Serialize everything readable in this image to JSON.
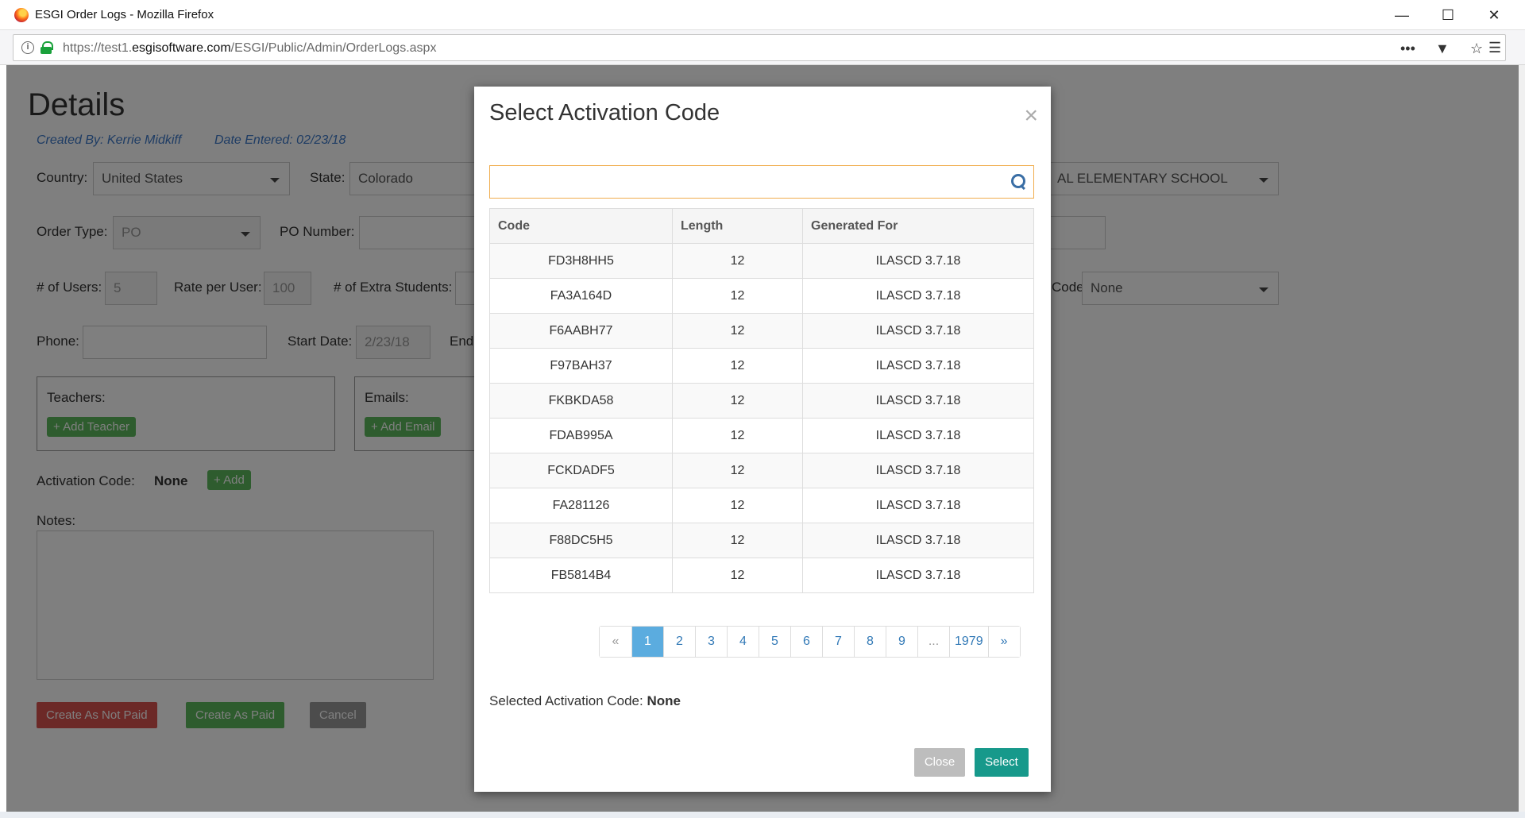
{
  "browser": {
    "window_title": "ESGI Order Logs - Mozilla Firefox",
    "url_prefix": "https://test1.",
    "url_domain": "esgisoftware.com",
    "url_path": "/ESGI/Public/Admin/OrderLogs.aspx"
  },
  "page": {
    "heading": "Details",
    "created_by": "Created By: Kerrie Midkiff",
    "date_entered": "Date Entered: 02/23/18",
    "country_label": "Country:",
    "country_value": "United States",
    "state_label": "State:",
    "state_value": "Colorado",
    "school_value": "AL ELEMENTARY SCHOOL",
    "order_type_label": "Order Type:",
    "order_type_value": "PO",
    "po_number_label": "PO Number:",
    "users_label": "# of Users:",
    "users_value": "5",
    "rate_label": "Rate per User:",
    "rate_value": "100",
    "extra_students_label": "# of Extra Students:",
    "code_label_partial": "Code:",
    "code_value": "None",
    "phone_label": "Phone:",
    "start_date_label": "Start Date:",
    "start_date_value": "2/23/18",
    "end_label_partial": "End",
    "teachers_label": "Teachers:",
    "add_teacher": "+ Add Teacher",
    "emails_label": "Emails:",
    "add_email": "+ Add Email",
    "activation_code_label": "Activation Code:",
    "activation_code_value": "None",
    "add_button": "+ Add",
    "notes_label": "Notes:",
    "create_not_paid": "Create As Not Paid",
    "create_paid": "Create As Paid",
    "cancel": "Cancel"
  },
  "modal": {
    "title": "Select Activation Code",
    "close_glyph": "×",
    "search_placeholder": "",
    "columns": [
      "Code",
      "Length",
      "Generated For"
    ],
    "rows": [
      {
        "code": "FD3H8HH5",
        "length": "12",
        "generated_for": "ILASCD 3.7.18"
      },
      {
        "code": "FA3A164D",
        "length": "12",
        "generated_for": "ILASCD 3.7.18"
      },
      {
        "code": "F6AABH77",
        "length": "12",
        "generated_for": "ILASCD 3.7.18"
      },
      {
        "code": "F97BAH37",
        "length": "12",
        "generated_for": "ILASCD 3.7.18"
      },
      {
        "code": "FKBKDA58",
        "length": "12",
        "generated_for": "ILASCD 3.7.18"
      },
      {
        "code": "FDAB995A",
        "length": "12",
        "generated_for": "ILASCD 3.7.18"
      },
      {
        "code": "FCKDADF5",
        "length": "12",
        "generated_for": "ILASCD 3.7.18"
      },
      {
        "code": "FA281126",
        "length": "12",
        "generated_for": "ILASCD 3.7.18"
      },
      {
        "code": "F88DC5H5",
        "length": "12",
        "generated_for": "ILASCD 3.7.18"
      },
      {
        "code": "FB5814B4",
        "length": "12",
        "generated_for": "ILASCD 3.7.18"
      }
    ],
    "pagination": [
      "«",
      "1",
      "2",
      "3",
      "4",
      "5",
      "6",
      "7",
      "8",
      "9",
      "...",
      "1979",
      "»"
    ],
    "active_page": "1",
    "selected_label": "Selected Activation Code:",
    "selected_value": "None",
    "close_button": "Close",
    "select_button": "Select"
  },
  "colors": {
    "accent_teal": "#17998b",
    "pager_active": "#5bacdf",
    "search_border": "#f0ad4e"
  }
}
